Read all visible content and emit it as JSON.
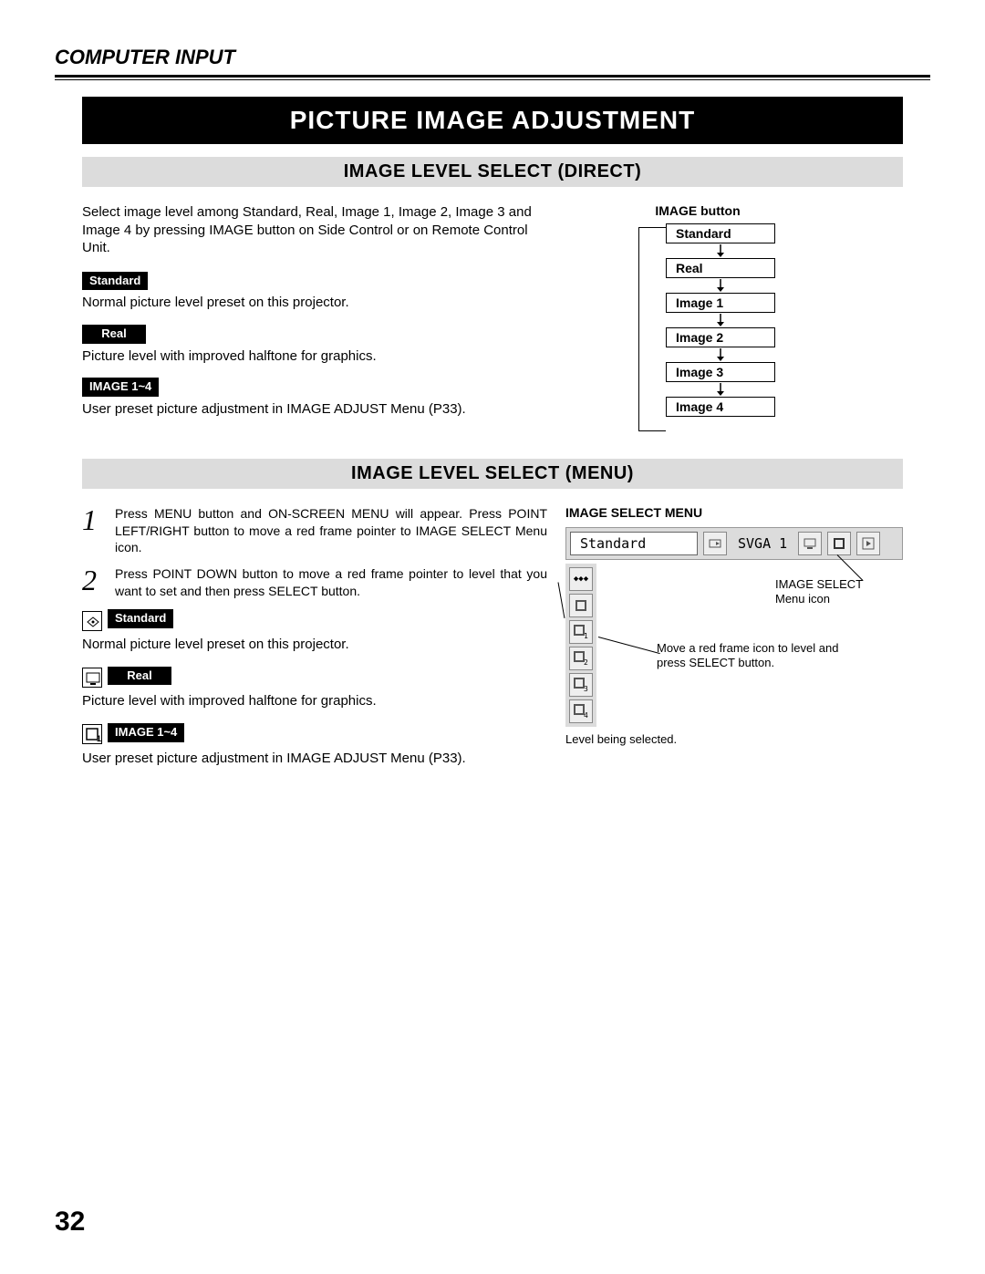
{
  "header": {
    "section_label": "COMPUTER INPUT"
  },
  "banner": "PICTURE IMAGE ADJUSTMENT",
  "direct": {
    "title": "IMAGE LEVEL SELECT (DIRECT)",
    "intro": "Select image level among Standard, Real, Image 1, Image 2, Image 3 and Image 4 by pressing IMAGE button on Side Control or on Remote Control Unit.",
    "items": [
      {
        "tag": "Standard",
        "desc": "Normal picture level preset on this projector."
      },
      {
        "tag": "Real",
        "desc": "Picture level with improved halftone for graphics."
      },
      {
        "tag": "IMAGE 1~4",
        "desc": "User preset picture adjustment in IMAGE ADJUST Menu (P33)."
      }
    ],
    "diagram": {
      "button_label": "IMAGE button",
      "states": [
        "Standard",
        "Real",
        "Image 1",
        "Image 2",
        "Image 3",
        "Image 4"
      ]
    }
  },
  "menu": {
    "title": "IMAGE LEVEL SELECT (MENU)",
    "steps": [
      "Press MENU button and ON-SCREEN MENU will appear.  Press POINT LEFT/RIGHT button to move a red frame pointer to IMAGE SELECT Menu icon.",
      "Press POINT DOWN button to move a red frame pointer to level that you want to set and then press SELECT button."
    ],
    "items": [
      {
        "tag": "Standard",
        "desc": "Normal picture level preset on this projector."
      },
      {
        "tag": "Real",
        "desc": "Picture level with improved halftone for graphics."
      },
      {
        "tag": "IMAGE 1~4",
        "desc": "User preset picture adjustment in IMAGE ADJUST Menu (P33)."
      }
    ],
    "screenshot": {
      "heading": "IMAGE SELECT MENU",
      "status_label": "Standard",
      "mode_label": "SVGA 1",
      "side_icons": [
        "⟡⟡⟡",
        "▣",
        "▣1",
        "▣2",
        "▣3",
        "▣4"
      ],
      "ann1": "IMAGE SELECT Menu icon",
      "ann2": "Move a red frame icon to level and press SELECT button.",
      "ann3": "Level being selected."
    }
  },
  "page_number": "32"
}
